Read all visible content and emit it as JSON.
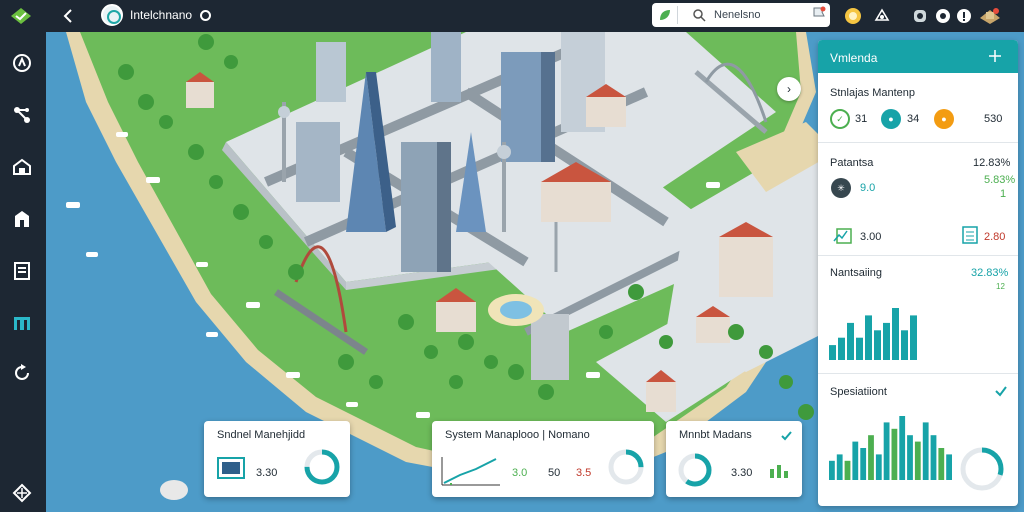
{
  "app": {
    "title": "Intelchnano",
    "search_text": "Nenelsno"
  },
  "sidebar": {
    "items": [
      {
        "icon": "compass-icon"
      },
      {
        "icon": "share-nodes-icon"
      },
      {
        "icon": "house-icon"
      },
      {
        "icon": "building-icon"
      },
      {
        "icon": "document-icon"
      },
      {
        "icon": "bank-icon"
      },
      {
        "icon": "refresh-icon"
      },
      {
        "icon": "move-icon"
      }
    ]
  },
  "panel": {
    "title": "Vmlenda",
    "section1": {
      "title": "Stnlajas Mantenp",
      "stat1": "31",
      "stat2": "34",
      "stat3": "530"
    },
    "section2": {
      "title": "Patantsa",
      "value_top": "12.83%",
      "value_green": "5.83%",
      "value_one": "1",
      "value_left": "9.0",
      "value_mid": "3.00",
      "value_right": "2.80"
    },
    "section3": {
      "title": "Nantsaiing",
      "value": "32.83%",
      "value_small": "12"
    },
    "section4": {
      "title": "Spesiatiiont"
    },
    "chart_mini": {
      "type": "bar",
      "values": [
        2,
        3,
        5,
        3,
        6,
        4,
        5,
        7,
        4,
        6
      ]
    },
    "chart_bottom": {
      "type": "bar",
      "values": [
        3,
        4,
        3,
        6,
        5,
        7,
        4,
        9,
        8,
        10,
        7,
        6,
        9,
        7,
        5,
        4
      ]
    },
    "donut_fraction": 0.3
  },
  "cards": [
    {
      "title": "Sndnel Manehjidd",
      "value": "3.30",
      "donut_fraction": 0.75
    },
    {
      "title": "System Manaplooo | Nomano",
      "value1": "3.0",
      "value2": "50",
      "value3": "3.5",
      "donut_fraction": 0.25
    },
    {
      "title": "Mnnbt Madans",
      "value": "3.30",
      "donut_fraction": 0.6
    }
  ],
  "colors": {
    "teal": "#17a3a8",
    "green": "#4caf50",
    "orange": "#f39c12",
    "dark": "#1d2733",
    "water": "#4d9bc8",
    "grass": "#6dbb5a"
  }
}
